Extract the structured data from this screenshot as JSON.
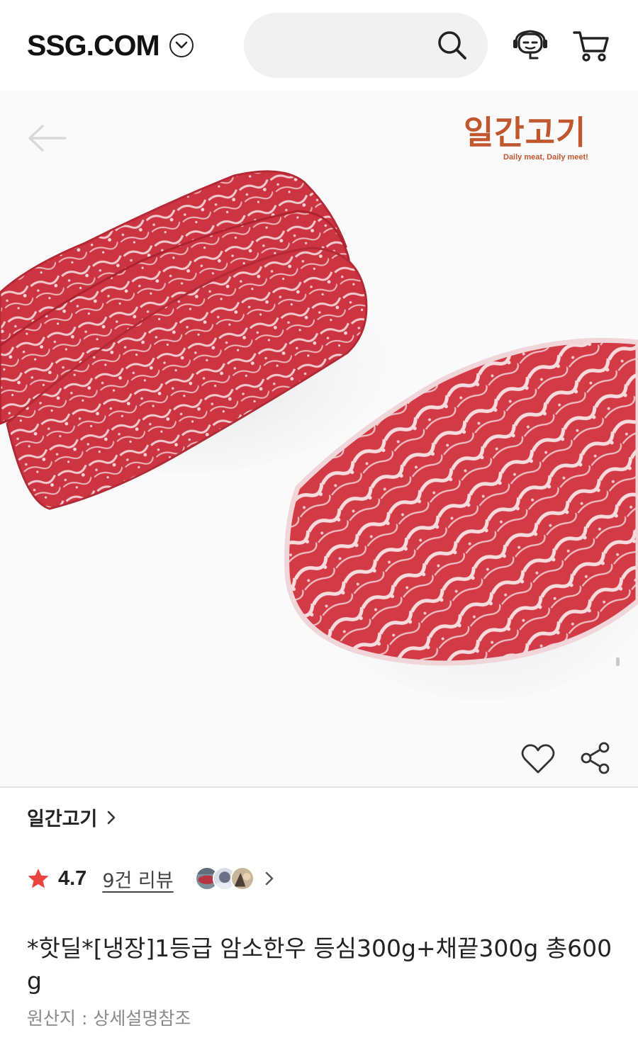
{
  "header": {
    "brand": "SSG.COM",
    "search": {
      "placeholder": ""
    },
    "icons": [
      "chevron-down-icon",
      "search-icon",
      "chatbot-icon",
      "cart-icon"
    ]
  },
  "product_image": {
    "seller_logo": {
      "main": "일간고기",
      "sub": "Daily meat, Daily meet!"
    },
    "icons": [
      "back-arrow-icon",
      "heart-icon",
      "share-icon"
    ]
  },
  "store": {
    "name": "일간고기"
  },
  "rating": {
    "value": "4.7",
    "reviews_label": "9건 리뷰",
    "star_color": "#e8433f"
  },
  "product": {
    "title": "*핫딜*[냉장]1등급 암소한우 등심300g+채끝300g 총600g",
    "origin": "원산지 : 상세설명참조"
  },
  "colors": {
    "logo": "#c0572e",
    "accent_star": "#e8433f",
    "meat": "#c9343d"
  }
}
